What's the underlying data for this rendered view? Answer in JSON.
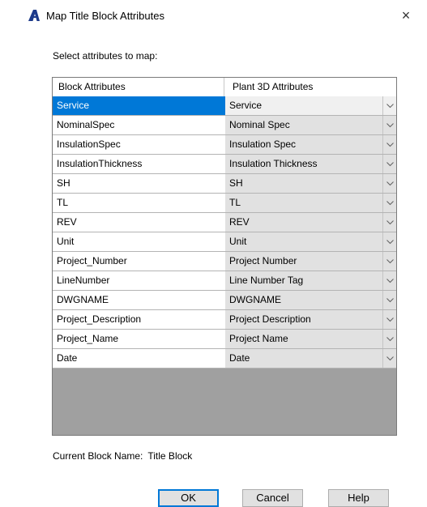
{
  "window": {
    "title": "Map Title Block Attributes",
    "close_glyph": "×",
    "icon": "autocad-a-icon",
    "accent_color": "#0078d7"
  },
  "prompt": "Select attributes to map:",
  "table": {
    "headers": [
      "Block Attributes",
      "Plant 3D Attributes"
    ],
    "selected_row": 0,
    "rows": [
      {
        "block": "Service",
        "plant": "Service"
      },
      {
        "block": "NominalSpec",
        "plant": "Nominal Spec"
      },
      {
        "block": "InsulationSpec",
        "plant": "Insulation Spec"
      },
      {
        "block": "InsulationThickness",
        "plant": "Insulation Thickness"
      },
      {
        "block": "SH",
        "plant": "SH"
      },
      {
        "block": "TL",
        "plant": "TL"
      },
      {
        "block": "REV",
        "plant": "REV"
      },
      {
        "block": "Unit",
        "plant": "Unit"
      },
      {
        "block": "Project_Number",
        "plant": "Project Number"
      },
      {
        "block": "LineNumber",
        "plant": "Line Number Tag"
      },
      {
        "block": "DWGNAME",
        "plant": "DWGNAME"
      },
      {
        "block": "Project_Description",
        "plant": "Project Description"
      },
      {
        "block": "Project_Name",
        "plant": "Project Name"
      },
      {
        "block": "Date",
        "plant": "Date"
      }
    ]
  },
  "current_block": {
    "label": "Current Block Name:",
    "value": "Title Block"
  },
  "buttons": {
    "ok": "OK",
    "cancel": "Cancel",
    "help": "Help"
  }
}
